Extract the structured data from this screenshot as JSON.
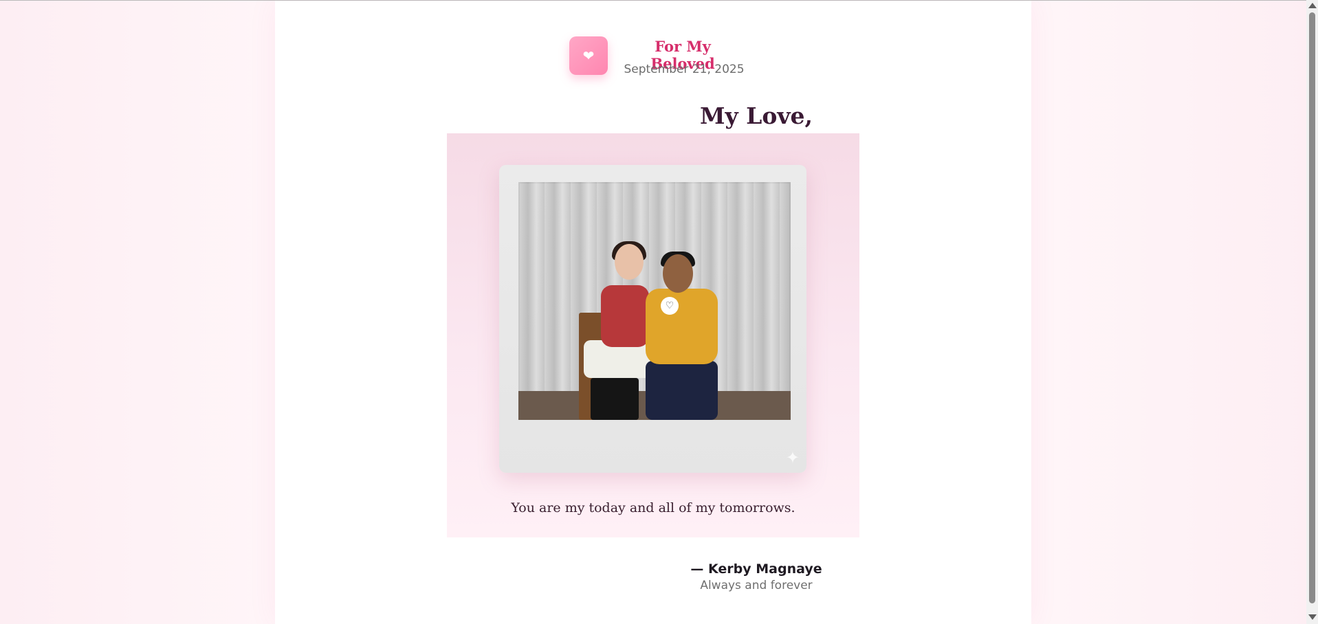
{
  "header": {
    "icon": "heart-icon",
    "title": "For My Beloved",
    "date": "September 21, 2025"
  },
  "letter": {
    "salutation": "My Love,",
    "photo_caption": "You are my today and all of my tomorrows.",
    "signature": "— Kerby Magnaye",
    "closing": "Always and forever"
  },
  "decor": {
    "sparkle_icon": "sparkle-icon"
  },
  "colors": {
    "accent": "#d62e6b",
    "badge": "#ff8db5",
    "heading": "#3a1a34"
  }
}
